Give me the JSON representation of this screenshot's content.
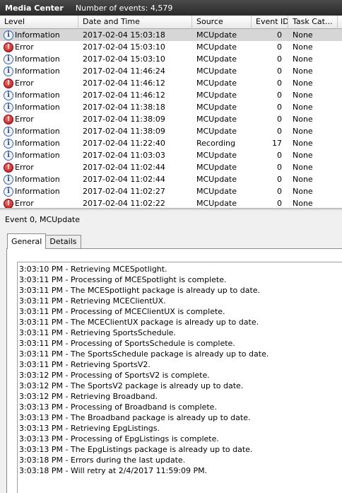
{
  "window": {
    "title": "Media Center",
    "events_count": "Number of events: 4,579"
  },
  "grid": {
    "columns": [
      "Level",
      "Date and Time",
      "Source",
      "Event ID",
      "Task Cat..."
    ],
    "rows": [
      {
        "level": "Information",
        "icon": "info-icon",
        "datetime": "2017-02-04 15:03:18",
        "source": "MCUpdate",
        "event_id": "0",
        "task": "None"
      },
      {
        "level": "Error",
        "icon": "error-icon",
        "datetime": "2017-02-04 15:03:10",
        "source": "MCUpdate",
        "event_id": "0",
        "task": "None"
      },
      {
        "level": "Information",
        "icon": "info-icon",
        "datetime": "2017-02-04 15:03:10",
        "source": "MCUpdate",
        "event_id": "0",
        "task": "None"
      },
      {
        "level": "Information",
        "icon": "info-icon",
        "datetime": "2017-02-04 11:46:24",
        "source": "MCUpdate",
        "event_id": "0",
        "task": "None"
      },
      {
        "level": "Error",
        "icon": "error-icon",
        "datetime": "2017-02-04 11:46:12",
        "source": "MCUpdate",
        "event_id": "0",
        "task": "None"
      },
      {
        "level": "Information",
        "icon": "info-icon",
        "datetime": "2017-02-04 11:46:12",
        "source": "MCUpdate",
        "event_id": "0",
        "task": "None"
      },
      {
        "level": "Information",
        "icon": "info-icon",
        "datetime": "2017-02-04 11:38:18",
        "source": "MCUpdate",
        "event_id": "0",
        "task": "None"
      },
      {
        "level": "Error",
        "icon": "error-icon",
        "datetime": "2017-02-04 11:38:09",
        "source": "MCUpdate",
        "event_id": "0",
        "task": "None"
      },
      {
        "level": "Information",
        "icon": "info-icon",
        "datetime": "2017-02-04 11:38:09",
        "source": "MCUpdate",
        "event_id": "0",
        "task": "None"
      },
      {
        "level": "Information",
        "icon": "info-icon",
        "datetime": "2017-02-04 11:22:40",
        "source": "Recording",
        "event_id": "17",
        "task": "None"
      },
      {
        "level": "Information",
        "icon": "info-icon",
        "datetime": "2017-02-04 11:03:03",
        "source": "MCUpdate",
        "event_id": "0",
        "task": "None"
      },
      {
        "level": "Error",
        "icon": "error-icon",
        "datetime": "2017-02-04 11:02:44",
        "source": "MCUpdate",
        "event_id": "0",
        "task": "None"
      },
      {
        "level": "Information",
        "icon": "info-icon",
        "datetime": "2017-02-04 11:02:44",
        "source": "MCUpdate",
        "event_id": "0",
        "task": "None"
      },
      {
        "level": "Information",
        "icon": "info-icon",
        "datetime": "2017-02-04 11:02:27",
        "source": "MCUpdate",
        "event_id": "0",
        "task": "None"
      },
      {
        "level": "Error",
        "icon": "error-icon",
        "datetime": "2017-02-04 11:02:22",
        "source": "MCUpdate",
        "event_id": "0",
        "task": "None"
      }
    ]
  },
  "detail": {
    "title": "Event 0, MCUpdate",
    "tabs": [
      {
        "label": "General"
      },
      {
        "label": "Details"
      }
    ],
    "log_lines": [
      "3:03:10 PM - Retrieving MCESpotlight.",
      "3:03:11 PM - Processing of MCESpotlight is complete.",
      "3:03:11 PM - The MCESpotlight package is already up to date.",
      "3:03:11 PM - Retrieving MCEClientUX.",
      "3:03:11 PM - Processing of MCEClientUX is complete.",
      "3:03:11 PM - The MCEClientUX package is already up to date.",
      "3:03:11 PM - Retrieving SportsSchedule.",
      "3:03:11 PM - Processing of SportsSchedule is complete.",
      "3:03:11 PM - The SportsSchedule package is already up to date.",
      "3:03:11 PM - Retrieving SportsV2.",
      "3:03:12 PM - Processing of SportsV2 is complete.",
      "3:03:12 PM - The SportsV2 package is already up to date.",
      "3:03:12 PM - Retrieving Broadband.",
      "3:03:13 PM - Processing of Broadband is complete.",
      "3:03:13 PM - The Broadband package is already up to date.",
      "3:03:13 PM - Retrieving EpgListings.",
      "3:03:13 PM - Processing of EpgListings is complete.",
      "3:03:13 PM - The EpgListings package is already up to date.",
      "3:03:18 PM - Errors during the last update.",
      "3:03:18 PM - Will retry at 2/4/2017 11:59:09 PM."
    ]
  }
}
